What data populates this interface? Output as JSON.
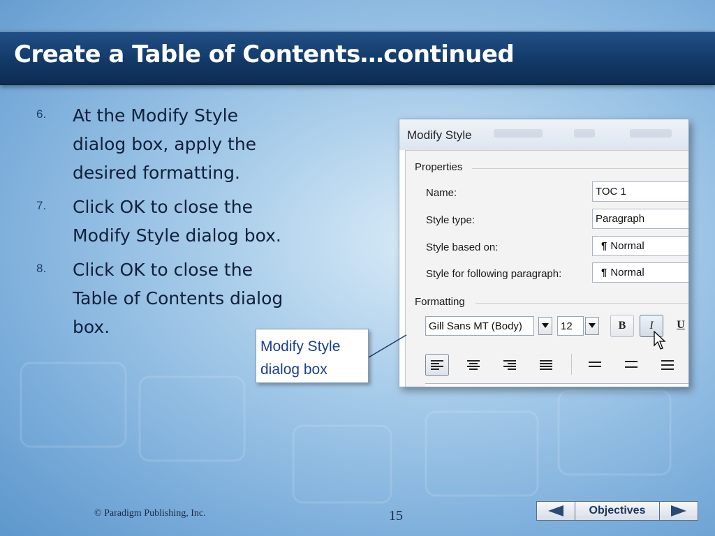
{
  "slide": {
    "title": "Create a Table of Contents…continued",
    "steps": [
      {
        "num": "6.",
        "text": "At the Modify Style dialog box, apply the desired formatting."
      },
      {
        "num": "7.",
        "text": "Click OK to close the Modify Style dialog box."
      },
      {
        "num": "8.",
        "text": "Click OK to close the Table of Contents dialog box."
      }
    ],
    "callout": "Modify Style dialog box",
    "footer": {
      "copyright": "© Paradigm Publishing, Inc.",
      "page": "15",
      "nav_label": "Objectives"
    }
  },
  "dialog": {
    "title": "Modify Style",
    "properties_label": "Properties",
    "properties": [
      {
        "label": "Name:",
        "value": "TOC 1"
      },
      {
        "label": "Style type:",
        "value": "Paragraph"
      },
      {
        "label": "Style based on:",
        "value": "Normal",
        "icon": "pilcrow-icon"
      },
      {
        "label": "Style for following paragraph:",
        "value": "Normal",
        "icon": "pilcrow-icon"
      }
    ],
    "formatting_label": "Formatting",
    "font": "Gill Sans MT (Body)",
    "size": "12",
    "bold_label": "B",
    "italic_label": "I",
    "underline_label": "U",
    "pilcrow": "¶"
  },
  "colors": {
    "title_bar": "#123a68",
    "callout_text": "#1a3f8f"
  }
}
